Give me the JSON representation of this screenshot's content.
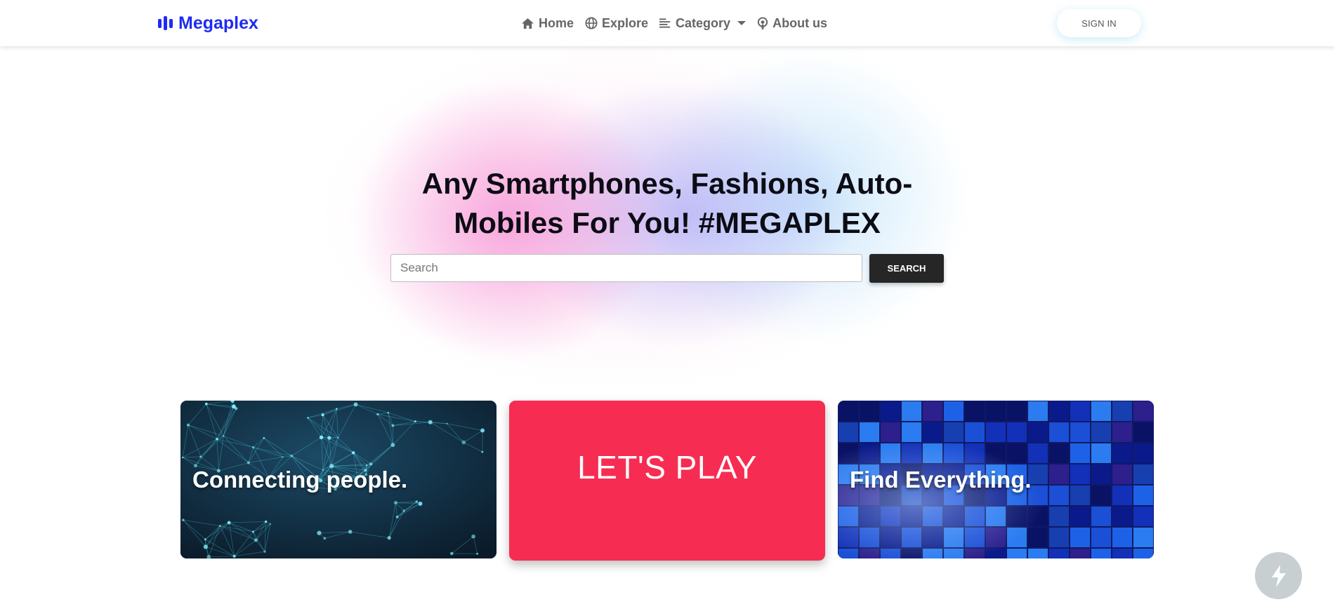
{
  "navbar": {
    "brand": "Megaplex",
    "links": [
      {
        "label": "Home",
        "icon": "home-icon"
      },
      {
        "label": "Explore",
        "icon": "globe-icon"
      },
      {
        "label": "Category",
        "icon": "list-icon"
      },
      {
        "label": "About us",
        "icon": "podcast-icon"
      }
    ],
    "signin_label": "SIGN IN"
  },
  "hero": {
    "title": "Any Smartphones, Fashions, Auto-Mobiles For You! #MEGAPLEX",
    "search_placeholder": "Search",
    "search_value": "",
    "search_button": "SEARCH"
  },
  "cards": [
    {
      "label": "Connecting people.",
      "image": "network-nodes-image"
    },
    {
      "label": "LET'S PLAY"
    },
    {
      "label": "Find Everything.",
      "image": "blue-tiles-image"
    }
  ],
  "fab": {
    "icon": "bolt-icon"
  },
  "colors": {
    "brand": "#1f2bf2",
    "play_card": "#f72c52",
    "search_button": "#262626"
  }
}
